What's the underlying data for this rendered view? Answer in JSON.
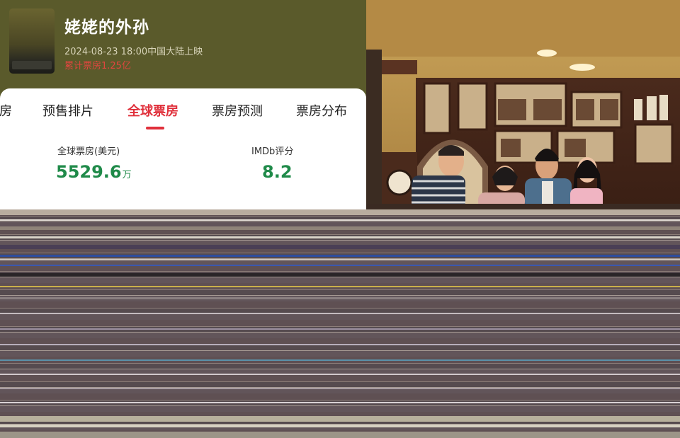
{
  "movie": {
    "title": "姥姥的外孙",
    "release": "2024-08-23 18:00中国大陆上映",
    "cumulative_box_office": "累计票房1.25亿"
  },
  "tabs": [
    {
      "label": "房",
      "active": false
    },
    {
      "label": "预售排片",
      "active": false
    },
    {
      "label": "全球票房",
      "active": true
    },
    {
      "label": "票房预测",
      "active": false
    },
    {
      "label": "票房分布",
      "active": false
    }
  ],
  "stats": {
    "global_box_office": {
      "label": "全球票房(美元)",
      "value": "5529.6",
      "unit": "万"
    },
    "imdb": {
      "label": "IMDb评分",
      "value": "8.2"
    }
  },
  "colors": {
    "header_bg": "#5a5a2b",
    "accent_red": "#e0303b",
    "value_green": "#1f8a49"
  }
}
